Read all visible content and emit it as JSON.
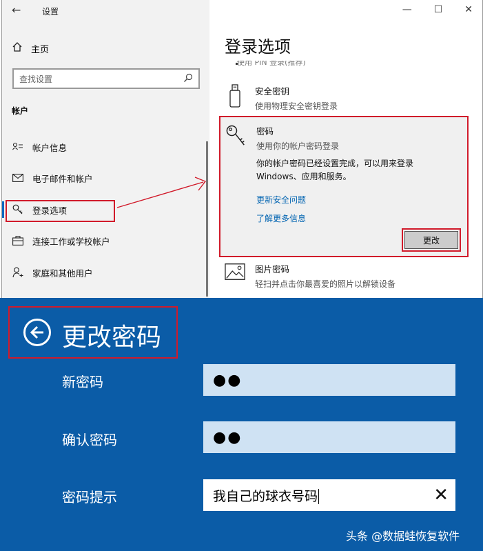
{
  "settings": {
    "title": "设置",
    "back_glyph": "←",
    "controls": {
      "minimize": "—",
      "maximize": "☐",
      "close": "✕"
    },
    "home_label": "主页",
    "search_placeholder": "查找设置",
    "section": "帐户",
    "nav_items": [
      {
        "label": "帐户信息",
        "icon": "person-card-icon"
      },
      {
        "label": "电子邮件和帐户",
        "icon": "mail-icon"
      },
      {
        "label": "登录选项",
        "icon": "key-icon",
        "active": true
      },
      {
        "label": "连接工作或学校帐户",
        "icon": "briefcase-icon"
      },
      {
        "label": "家庭和其他用户",
        "icon": "person-add-icon"
      }
    ]
  },
  "content": {
    "page_title": "登录选项",
    "pin_partial": "使用 PIN 登录(推荐)",
    "security_key": {
      "title": "安全密钥",
      "desc": "使用物理安全密钥登录"
    },
    "password": {
      "title": "密码",
      "desc": "使用你的帐户密码登录",
      "info": "你的帐户密码已经设置完成，可以用来登录 Windows、应用和服务。",
      "link_security_questions": "更新安全问题",
      "link_learn_more": "了解更多信息",
      "change_button": "更改"
    },
    "picture_password": {
      "title": "图片密码",
      "desc": "轻扫并点击你最喜爱的照片以解锁设备"
    }
  },
  "dialog": {
    "title": "更改密码",
    "background_color": "#0b5ca7",
    "fields": {
      "new_password": {
        "label": "新密码",
        "value": "●●"
      },
      "confirm_password": {
        "label": "确认密码",
        "value": "●●"
      },
      "hint": {
        "label": "密码提示",
        "value": "我自己的球衣号码",
        "clear": "✕"
      }
    }
  },
  "watermark": "头条 @数据蛙恢复软件"
}
